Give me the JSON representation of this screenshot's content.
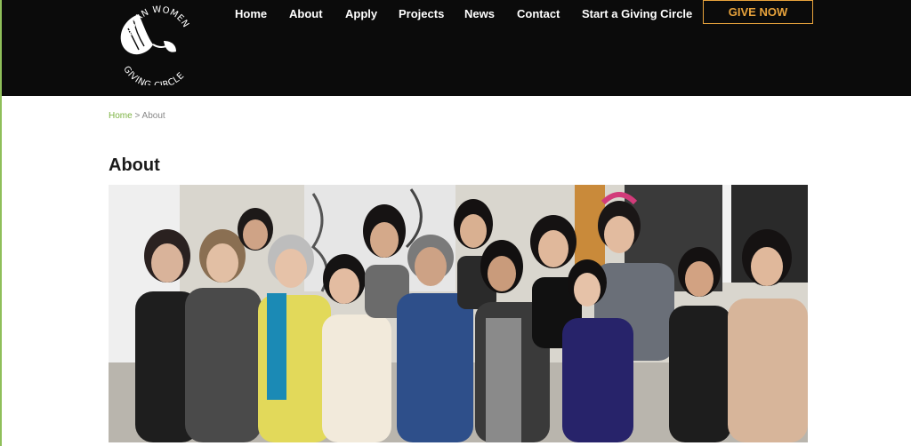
{
  "logo": {
    "line1": "ASIAN WOMEN",
    "line2": "GIVING CIRCLE"
  },
  "nav": {
    "items": [
      {
        "label": "Home"
      },
      {
        "label": "About"
      },
      {
        "label": "Apply"
      },
      {
        "label": "Projects"
      },
      {
        "label": "News"
      },
      {
        "label": "Contact"
      },
      {
        "label": "Start a Giving Circle"
      }
    ],
    "give_label": "GIVE NOW"
  },
  "breadcrumb": {
    "home": "Home",
    "separator": " > ",
    "current": "About"
  },
  "page": {
    "title": "About"
  },
  "photo": {
    "subject": "group photo of women"
  },
  "colors": {
    "header_bg": "#0b0b0b",
    "accent_orange": "#e8a33c",
    "link_green": "#7cb342"
  }
}
